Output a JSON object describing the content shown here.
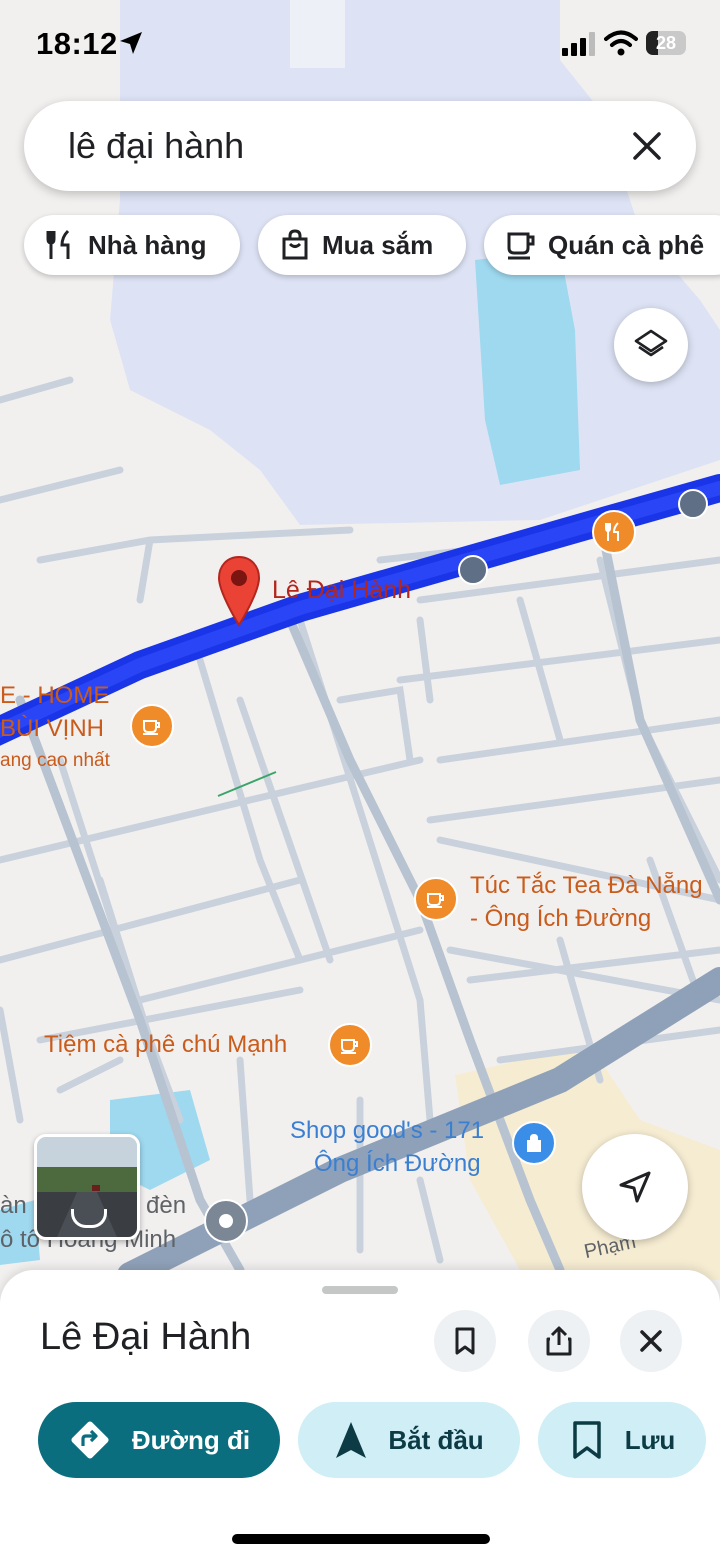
{
  "status_bar": {
    "time": "18:12",
    "battery": "28"
  },
  "search": {
    "query": "lê đại hành"
  },
  "chips": [
    {
      "label": "Nhà hàng",
      "icon": "restaurant-icon"
    },
    {
      "label": "Mua sắm",
      "icon": "shopping-bag-icon"
    },
    {
      "label": "Quán cà phê",
      "icon": "coffee-icon"
    }
  ],
  "map": {
    "selected_place": "Lê Đại Hành",
    "poi_labels": {
      "home_line1": "E - HOME",
      "home_line2": "BÙI VỊNH",
      "home_line3": "ang cao nhất",
      "tuc_tac_line1": "Túc Tắc Tea Đà Nẵng",
      "tuc_tac_line2": "- Ông Ích Đường",
      "tiem_ca_phe": "Tiệm cà phê chú Mạnh",
      "shop_line1": "Shop good's - 171",
      "shop_line2": "Ông Ích Đường",
      "hoang_minh_line1": "àn",
      "hoang_minh_line1b": "đèn",
      "hoang_minh_line2": "ô tô Hoàng Minh",
      "street_pham": "Phạm"
    }
  },
  "sheet": {
    "title": "Lê Đại Hành",
    "actions": {
      "directions": "Đường đi",
      "start": "Bắt đầu",
      "save": "Lưu"
    }
  },
  "colors": {
    "accent": "#0b6e7f",
    "route_blue": "#1a35e8",
    "poi_orange": "#f08b29",
    "water": "#9fd9ef",
    "pin_red": "#ea4335"
  }
}
